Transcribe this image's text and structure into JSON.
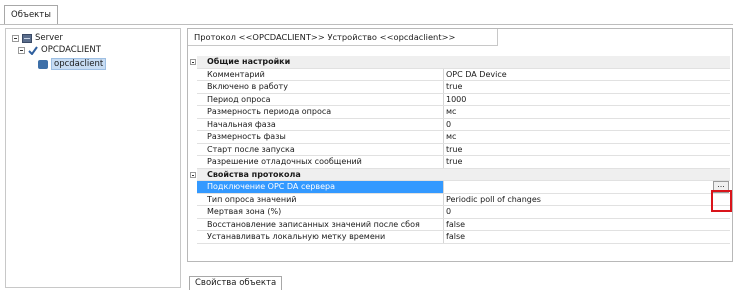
{
  "top_tab": "Объекты",
  "tree": {
    "server": "Server",
    "opcdaclient": "OPCDACLIENT",
    "device": "opcdaclient"
  },
  "panel_title": "Протокол <<OPCDACLIENT>> Устройство <<opcdaclient>>",
  "rows": [
    {
      "kind": "category",
      "name": "Общие настройки",
      "value": ""
    },
    {
      "kind": "prop",
      "name": "Комментарий",
      "value": "OPC DA Device"
    },
    {
      "kind": "prop",
      "name": "Включено в работу",
      "value": "true"
    },
    {
      "kind": "prop",
      "name": "Период опроса",
      "value": "1000"
    },
    {
      "kind": "prop",
      "name": "Размерность периода опроса",
      "value": "мс"
    },
    {
      "kind": "prop",
      "name": "Начальная фаза",
      "value": "0"
    },
    {
      "kind": "prop",
      "name": "Размерность фазы",
      "value": "мс"
    },
    {
      "kind": "prop",
      "name": "Старт после запуска",
      "value": "true"
    },
    {
      "kind": "prop",
      "name": "Разрешение отладочных сообщений",
      "value": "true"
    },
    {
      "kind": "category",
      "name": "Свойства протокола",
      "value": ""
    },
    {
      "kind": "prop",
      "name": "Подключение OPC DA сервера",
      "value": "",
      "selected": true
    },
    {
      "kind": "prop",
      "name": "Тип опроса значений",
      "value": "Periodic poll of changes"
    },
    {
      "kind": "prop",
      "name": "Мертвая зона (%)",
      "value": "0"
    },
    {
      "kind": "prop",
      "name": "Восстановление записанных значений после сбоя",
      "value": "false"
    },
    {
      "kind": "prop",
      "name": "Устанавливать локальную метку времени",
      "value": "false"
    }
  ],
  "edit_button": "...",
  "bottom_tab": "Свойства объекта",
  "colors": {
    "selection": "#3399ff",
    "highlight_box": "#d9141b",
    "category_bg": "#efefef"
  }
}
